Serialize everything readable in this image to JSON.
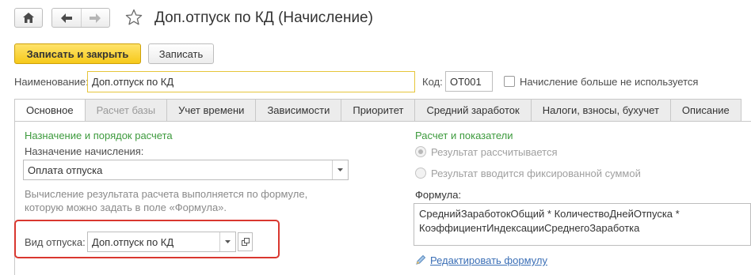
{
  "window": {
    "title": "Доп.отпуск по КД (Начисление)"
  },
  "nav": {
    "home_icon": "home-icon",
    "back_icon": "arrow-left-icon",
    "forward_icon": "arrow-right-icon",
    "favorite_icon": "star-icon"
  },
  "toolbar": {
    "save_close_label": "Записать и закрыть",
    "save_label": "Записать"
  },
  "header": {
    "name_label": "Наименование:",
    "name_value": "Доп.отпуск по КД",
    "code_label": "Код:",
    "code_value": "ОТ001",
    "not_used_label": "Начисление больше не используется",
    "not_used_checked": false
  },
  "tabs": [
    {
      "label": "Основное",
      "active": true,
      "disabled": false
    },
    {
      "label": "Расчет базы",
      "active": false,
      "disabled": true
    },
    {
      "label": "Учет времени",
      "active": false,
      "disabled": false
    },
    {
      "label": "Зависимости",
      "active": false,
      "disabled": false
    },
    {
      "label": "Приоритет",
      "active": false,
      "disabled": false
    },
    {
      "label": "Средний заработок",
      "active": false,
      "disabled": false
    },
    {
      "label": "Налоги, взносы, бухучет",
      "active": false,
      "disabled": false
    },
    {
      "label": "Описание",
      "active": false,
      "disabled": false
    }
  ],
  "left": {
    "section_title": "Назначение и порядок расчета",
    "purpose_label": "Назначение начисления:",
    "purpose_value": "Оплата отпуска",
    "note_line1": "Вычисление результата расчета выполняется по формуле,",
    "note_line2": "которую можно задать в поле «Формула».",
    "vacation_label": "Вид отпуска:",
    "vacation_value": "Доп.отпуск по КД"
  },
  "right": {
    "section_title": "Расчет и показатели",
    "radio_calculated": "Результат рассчитывается",
    "radio_fixed": "Результат вводится фиксированной суммой",
    "formula_label": "Формула:",
    "formula_line1": "СреднийЗаработокОбщий * КоличествоДнейОтпуска *",
    "formula_line2": "КоэффициентИндексацииСреднегоЗаработка",
    "edit_formula_link": "Редактировать формулу"
  },
  "colors": {
    "accent_yellow": "#f6c91a",
    "section_green": "#3d9a3d",
    "highlight_red": "#d9372f",
    "link_blue": "#3b6fb6"
  }
}
